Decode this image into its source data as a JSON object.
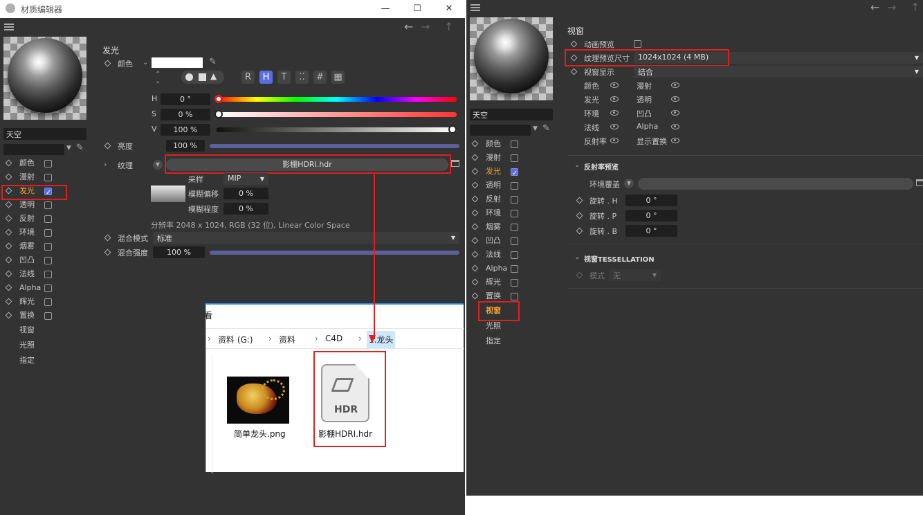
{
  "window1": {
    "title": "材质编辑器",
    "material_name": "天空",
    "channels": [
      {
        "label": "颜色",
        "checked": false
      },
      {
        "label": "漫射",
        "checked": false
      },
      {
        "label": "发光",
        "checked": true
      },
      {
        "label": "透明",
        "checked": false
      },
      {
        "label": "反射",
        "checked": false
      },
      {
        "label": "环境",
        "checked": false
      },
      {
        "label": "烟雾",
        "checked": false
      },
      {
        "label": "凹凸",
        "checked": false
      },
      {
        "label": "法线",
        "checked": false
      },
      {
        "label": "Alpha",
        "checked": false
      },
      {
        "label": "辉光",
        "checked": false
      },
      {
        "label": "置换",
        "checked": false
      }
    ],
    "extra_items": [
      "视窗",
      "光照",
      "指定"
    ],
    "section_title": "发光",
    "color_label": "颜色",
    "mode_buttons": [
      "R",
      "H",
      "T",
      "⁚⁚",
      "#",
      "▦"
    ],
    "hsv": [
      {
        "label": "H",
        "value": "0 °"
      },
      {
        "label": "S",
        "value": "0 %"
      },
      {
        "label": "V",
        "value": "100 %"
      }
    ],
    "brightness": {
      "label": "亮度",
      "value": "100 %"
    },
    "texture": {
      "label": "纹理",
      "file": "影棚HDRI.hdr"
    },
    "sampling": {
      "label": "采样",
      "value": "MIP"
    },
    "blur_offset": {
      "label": "模糊偏移",
      "value": "0 %"
    },
    "blur_degree": {
      "label": "模糊程度",
      "value": "0 %"
    },
    "resolution": "分辨率 2048 x 1024, RGB (32 位), Linear Color Space",
    "blend_mode": {
      "label": "混合模式",
      "value": "标准"
    },
    "blend_strength": {
      "label": "混合强度",
      "value": "100 %"
    }
  },
  "explorer": {
    "title_fragment": "看",
    "breadcrumb": [
      "资料 (G:)",
      "资料",
      "C4D",
      "1.龙头"
    ],
    "files": [
      {
        "name": "简单龙头.png",
        "icon": "dragon-thumbnail"
      },
      {
        "name": "影棚HDRI.hdr",
        "icon": "hdr-file-icon",
        "badge": "HDR"
      }
    ]
  },
  "window2": {
    "material_name": "天空",
    "channels": [
      {
        "label": "颜色",
        "checked": false
      },
      {
        "label": "漫射",
        "checked": false
      },
      {
        "label": "发光",
        "checked": true
      },
      {
        "label": "透明",
        "checked": false
      },
      {
        "label": "反射",
        "checked": false
      },
      {
        "label": "环境",
        "checked": false
      },
      {
        "label": "烟雾",
        "checked": false
      },
      {
        "label": "凹凸",
        "checked": false
      },
      {
        "label": "法线",
        "checked": false
      },
      {
        "label": "Alpha",
        "checked": false
      },
      {
        "label": "辉光",
        "checked": false
      },
      {
        "label": "置换",
        "checked": false
      }
    ],
    "extra_items": [
      "视窗",
      "光照",
      "指定"
    ],
    "section_title": "视窗",
    "anim_preview": "动画预览",
    "tex_preview": {
      "label": "纹理预览尺寸",
      "value": "1024x1024 (4 MB)"
    },
    "viewport_display": {
      "label": "视窗显示",
      "value": "结合"
    },
    "visibility_grid": [
      [
        "颜色",
        "漫射"
      ],
      [
        "发光",
        "透明"
      ],
      [
        "环境",
        "凹凸"
      ],
      [
        "法线",
        "Alpha"
      ],
      [
        "反射率",
        "显示置换"
      ]
    ],
    "reflect_preview": "反射率预览",
    "env_override": "环境覆盖",
    "rotations": [
      {
        "label": "旋转 . H",
        "value": "0 °"
      },
      {
        "label": "旋转 . P",
        "value": "0 °"
      },
      {
        "label": "旋转 . B",
        "value": "0 °"
      }
    ],
    "tessellation": "视窗TESSELLATION",
    "mode": {
      "label": "模式",
      "value": "无"
    }
  },
  "colors": {
    "accent": "#e02020",
    "highlight": "#f0a030",
    "slider": "#5b5f9a"
  }
}
